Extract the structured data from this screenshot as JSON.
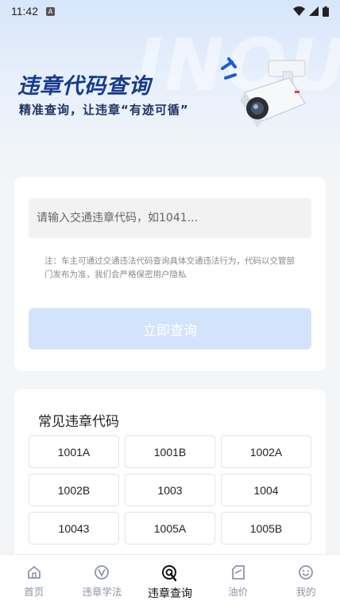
{
  "status_bar": {
    "time": "11:42",
    "notification_glyph": "A"
  },
  "hero": {
    "title": "违章代码查询",
    "subtitle": "精准查询，让违章“有迹可循”",
    "watermark": "INQU"
  },
  "query": {
    "input_placeholder": "请输入交通违章代码，如1041...",
    "input_value": "",
    "note": "注：车主可通过交通违法代码查询具体交通违法行为，代码以交管部门发布为准，我们会严格保密用户隐私",
    "submit_label": "立即查询"
  },
  "common_codes": {
    "title": "常见违章代码",
    "codes": [
      "1001A",
      "1001B",
      "1002A",
      "1002B",
      "1003",
      "1004",
      "10043",
      "1005A",
      "1005B"
    ]
  },
  "tabs": [
    {
      "label": "首页",
      "icon": "home-icon",
      "active": false
    },
    {
      "label": "违章学法",
      "icon": "study-icon",
      "active": false
    },
    {
      "label": "违章查询",
      "icon": "query-icon",
      "active": true
    },
    {
      "label": "油价",
      "icon": "oil-price-icon",
      "active": false
    },
    {
      "label": "我的",
      "icon": "profile-icon",
      "active": false
    }
  ],
  "colors": {
    "accent": "#163a8c",
    "button_disabled": "#d3e3fc",
    "tab_inactive": "#8d96a8",
    "tab_active": "#111111"
  }
}
